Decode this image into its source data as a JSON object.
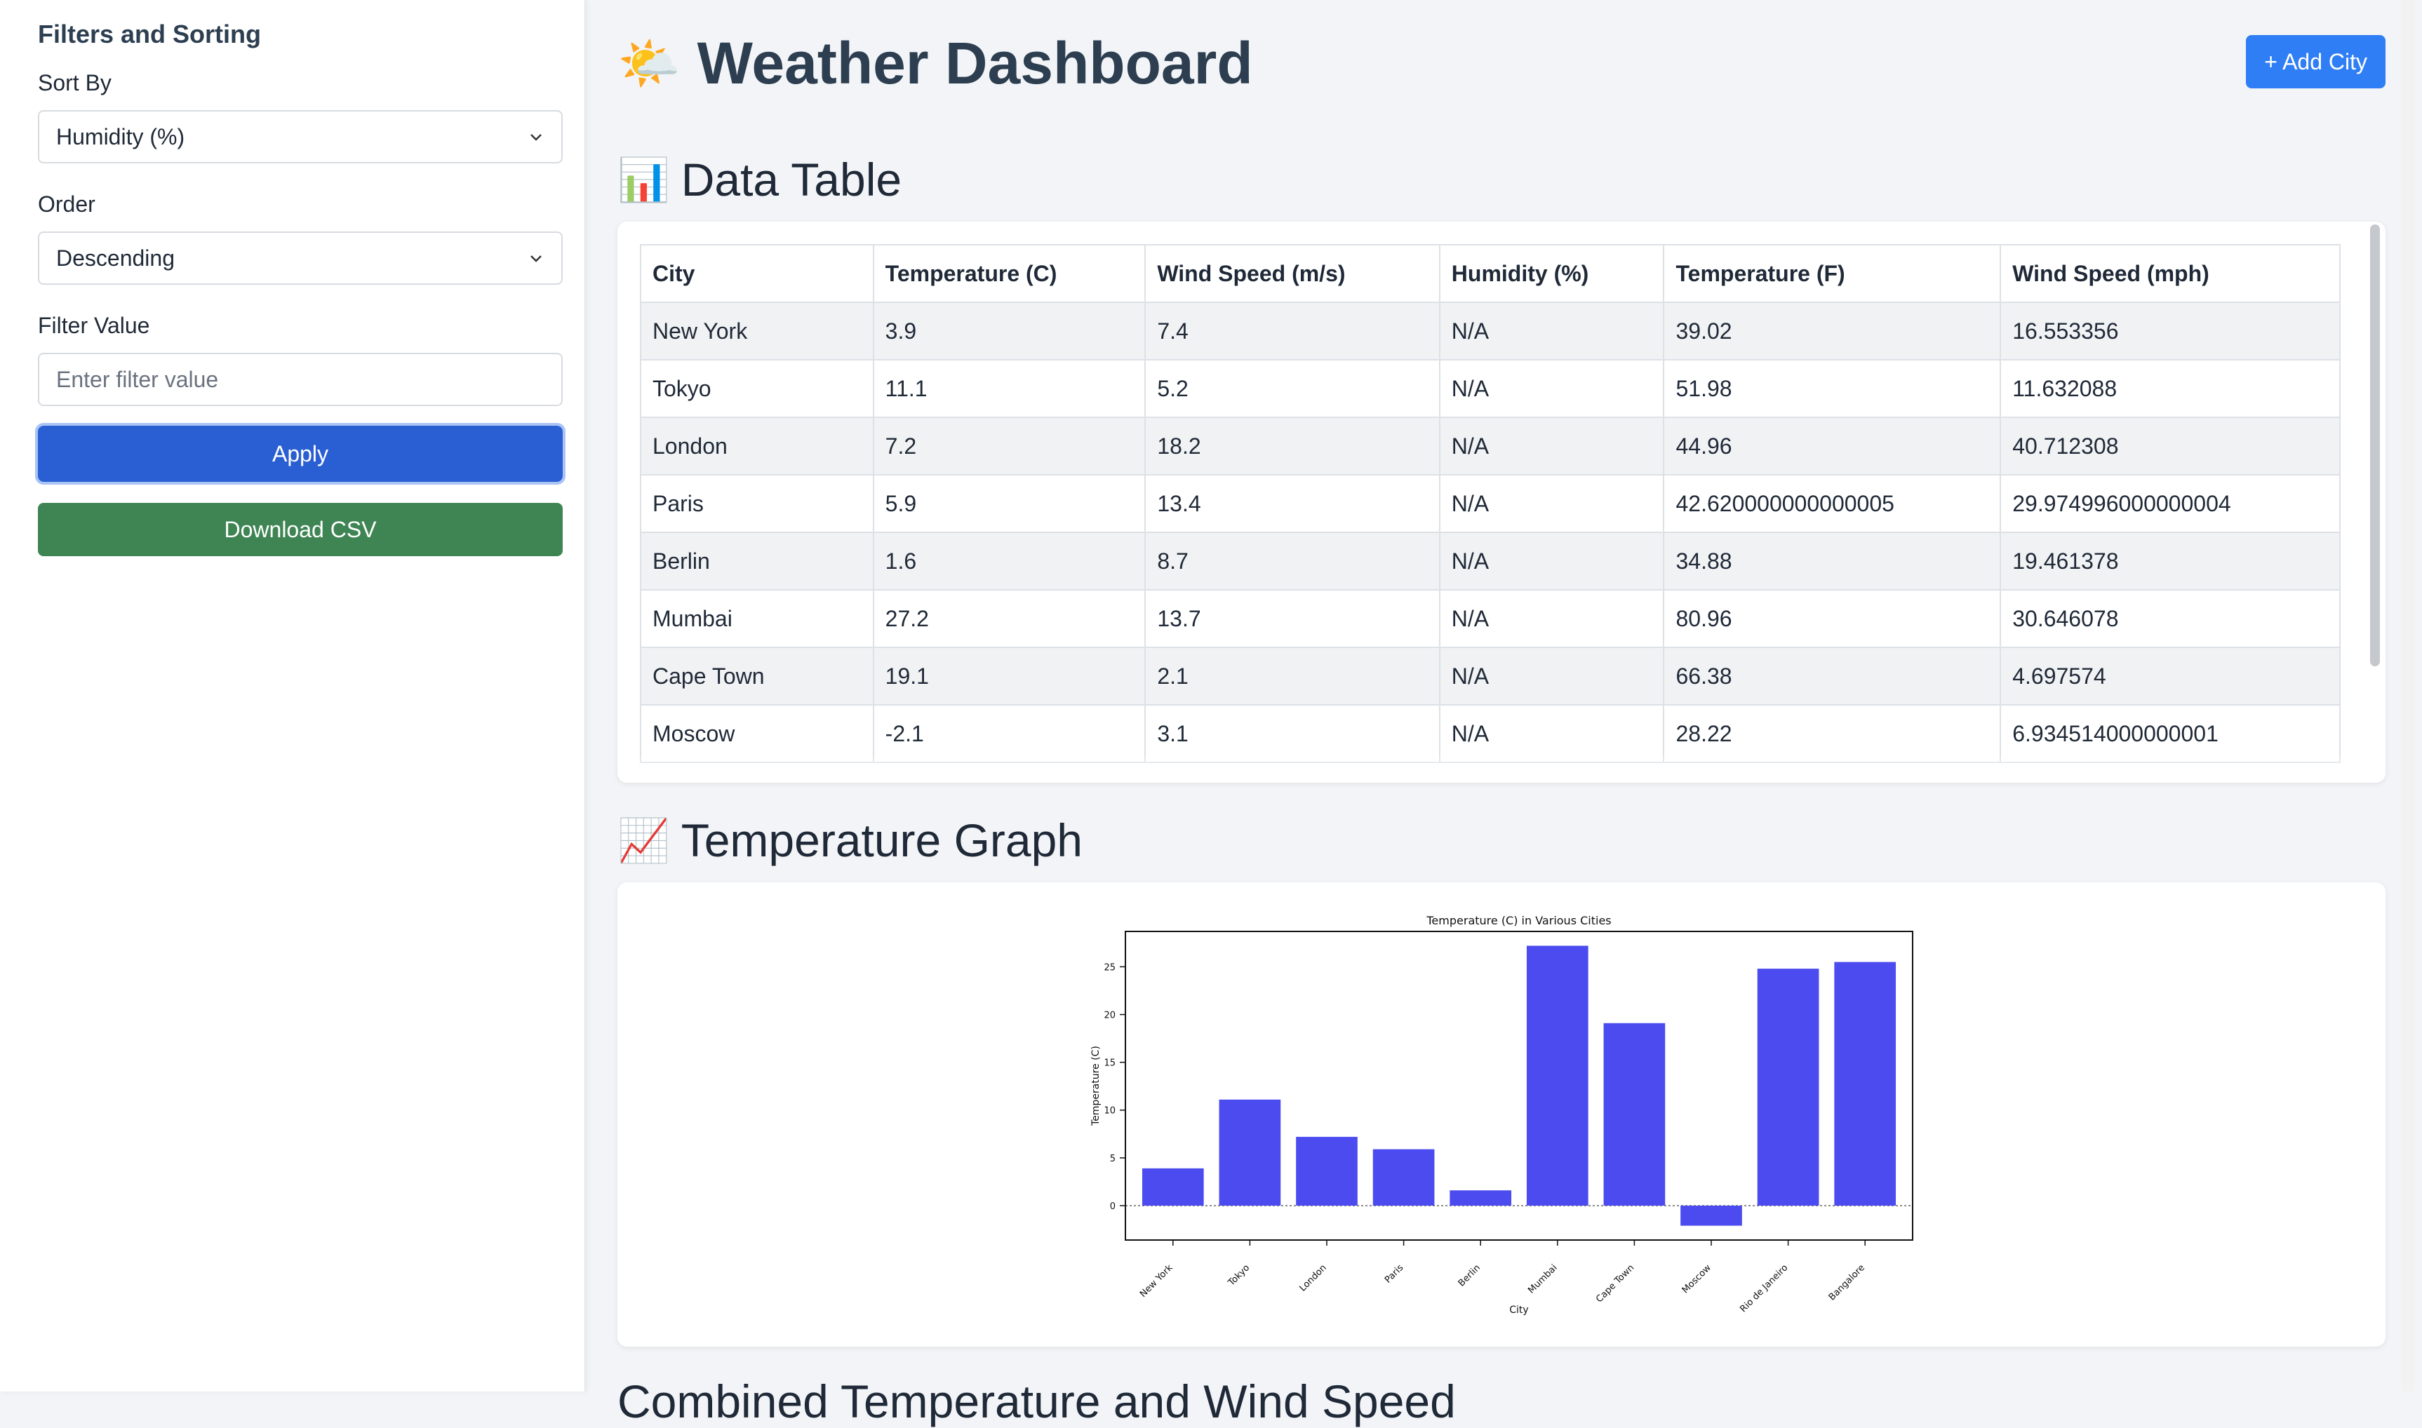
{
  "sidebar": {
    "title": "Filters and Sorting",
    "sort_by_label": "Sort By",
    "sort_by_value": "Humidity (%)",
    "order_label": "Order",
    "order_value": "Descending",
    "filter_label": "Filter Value",
    "filter_placeholder": "Enter filter value",
    "apply_label": "Apply",
    "download_label": "Download CSV"
  },
  "header": {
    "emoji": "🌤️",
    "title": "Weather Dashboard",
    "add_city_label": "+ Add City"
  },
  "data_table": {
    "emoji": "📊",
    "title": "Data Table",
    "columns": [
      "City",
      "Temperature (C)",
      "Wind Speed (m/s)",
      "Humidity (%)",
      "Temperature (F)",
      "Wind Speed (mph)"
    ],
    "rows": [
      [
        "New York",
        "3.9",
        "7.4",
        "N/A",
        "39.02",
        "16.553356"
      ],
      [
        "Tokyo",
        "11.1",
        "5.2",
        "N/A",
        "51.98",
        "11.632088"
      ],
      [
        "London",
        "7.2",
        "18.2",
        "N/A",
        "44.96",
        "40.712308"
      ],
      [
        "Paris",
        "5.9",
        "13.4",
        "N/A",
        "42.620000000000005",
        "29.974996000000004"
      ],
      [
        "Berlin",
        "1.6",
        "8.7",
        "N/A",
        "34.88",
        "19.461378"
      ],
      [
        "Mumbai",
        "27.2",
        "13.7",
        "N/A",
        "80.96",
        "30.646078"
      ],
      [
        "Cape Town",
        "19.1",
        "2.1",
        "N/A",
        "66.38",
        "4.697574"
      ],
      [
        "Moscow",
        "-2.1",
        "3.1",
        "N/A",
        "28.22",
        "6.934514000000001"
      ]
    ]
  },
  "temperature_graph": {
    "emoji": "📈",
    "title": "Temperature Graph"
  },
  "next_section": {
    "title": "Combined Temperature and Wind Speed"
  },
  "chart_data": {
    "type": "bar",
    "title": "Temperature (C) in Various Cities",
    "xlabel": "City",
    "ylabel": "Temperature (C)",
    "categories": [
      "New York",
      "Tokyo",
      "London",
      "Paris",
      "Berlin",
      "Mumbai",
      "Cape Town",
      "Moscow",
      "Rio de Janeiro",
      "Bangalore"
    ],
    "values": [
      3.9,
      11.1,
      7.2,
      5.9,
      1.6,
      27.2,
      19.1,
      -2.1,
      24.8,
      25.5
    ],
    "yticks": [
      "0",
      "5",
      "10",
      "15",
      "20",
      "25"
    ],
    "ylim": [
      -3.6,
      28.7
    ],
    "bar_color": "#4b4bf0",
    "grid": false
  }
}
